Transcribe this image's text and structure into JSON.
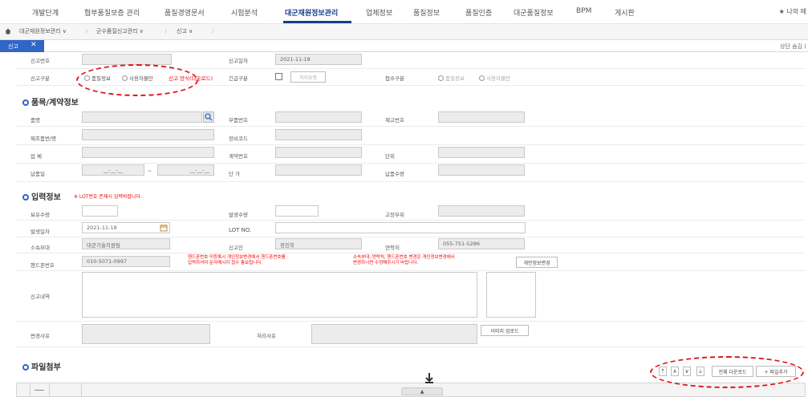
{
  "menu": {
    "items": [
      "개발단계",
      "협부품질보증 관리",
      "품질경영문서",
      "시험분석",
      "대군재원정보관리",
      "업체정보",
      "품질정보",
      "품질인증",
      "대군품질정보",
      "BPM",
      "게시판"
    ],
    "active": "대군재원정보관리",
    "bookmark": "★ 나의 메"
  },
  "breadcrumb": {
    "home_icon": "home-icon",
    "items": [
      "대군재원정보관리 ∨",
      "군수품질신고관리 ∨",
      "신고 ∨"
    ]
  },
  "tab": {
    "label": "신고",
    "close": "✕"
  },
  "top_right_text": "상단 숨김 (",
  "form1": {
    "report_no_label": "신고번호",
    "report_date_label": "신고일자",
    "report_date_value": "2021-11-18",
    "report_type_label": "신고구분",
    "radio_quality": "품질정보",
    "radio_claim": "사용자불만",
    "red_note": "신고 양식(다운로드)",
    "urgent_label": "긴급구분",
    "urgent_btn": "처리요청",
    "receipt_type_label": "접수구분",
    "receipt_radio1": "품질정보",
    "receipt_radio2": "사용자불만"
  },
  "section_item": {
    "title": "품목/계약정보"
  },
  "item": {
    "product_name": "품명",
    "part_no": "부품번호",
    "stock_no": "재고번호",
    "maker_item": "제조품번/명",
    "drawing_code": "장비코드",
    "company": "업  체",
    "contract_no": "계약번호",
    "unit": "단위",
    "delivery_date": "납품일",
    "date_ph": "__-__-__",
    "tilde": "~",
    "unit_price": "단  가",
    "delivery_qty": "납품수량"
  },
  "section_input": {
    "title": "입력정보",
    "note": "※ LOT번호 존재시 입력바랍니다."
  },
  "input": {
    "hold_qty": "보유수량",
    "occur_qty": "발생수량",
    "defect_loc": "고장부위",
    "occur_date": "발생일자",
    "occur_date_value": "2021-11-18",
    "lot_no": "LOT NO.",
    "dept": "소속부대",
    "dept_value": "대군기술지원팀",
    "reporter": "신고인",
    "reporter_value": "정진욱",
    "contact": "연락처",
    "contact_value": "055-751-5286",
    "phone": "핸드폰번호",
    "phone_value": "010-5071-0997",
    "red_note1": "핸드폰번호 미등록시 개인정보변경에서 핸드폰번호를\n입력하셔야 문자메시지 접수 통보됩니다.",
    "red_note2": "소속부대, 연락처, 핸드폰번호 변경은 개인정보변경에서\n변경하시면 수정해주시기 바랍니다.",
    "personal_btn": "개인정보변경",
    "content": "신고내역",
    "change": "변경사유",
    "process": "처리사유",
    "upload_btn": "이미지 업로드"
  },
  "section_file": {
    "title": "파일첨부"
  },
  "file_bar": {
    "btn_top": "⇡",
    "btn_up": "∧",
    "btn_down": "∨",
    "btn_bottom": "⇣",
    "download_all": "전체 다운로드",
    "add_file": "+ 파일추가"
  },
  "accent": "#2f66c8",
  "alert_red": "#e0141a"
}
